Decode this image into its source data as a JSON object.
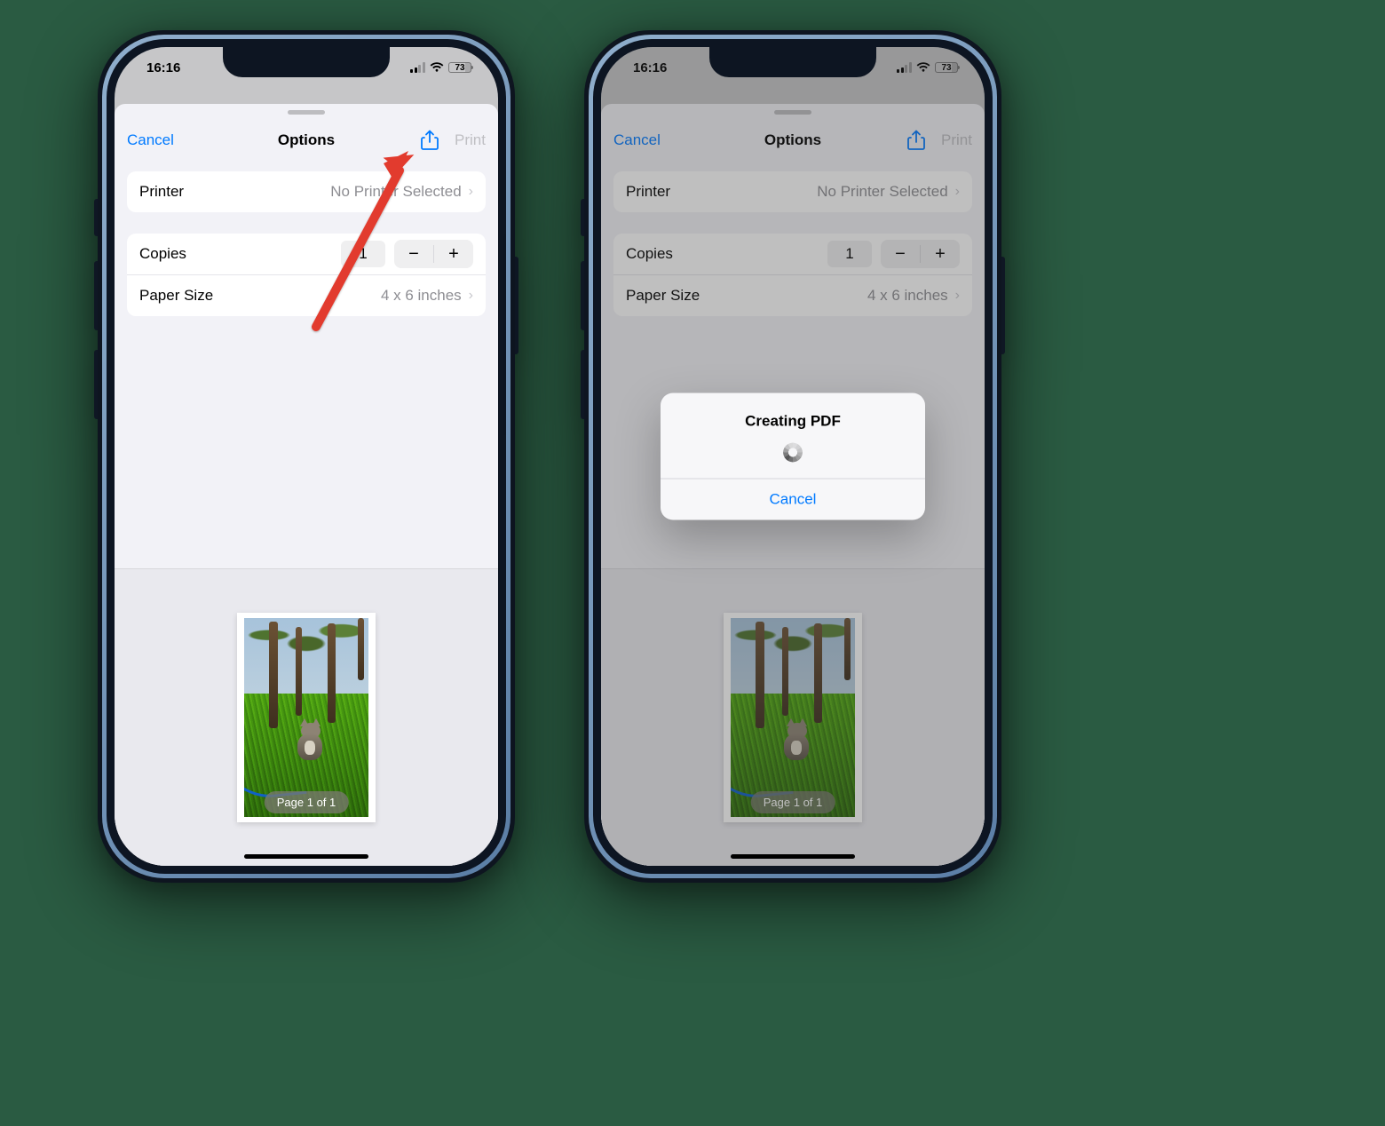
{
  "status": {
    "time": "16:16",
    "battery": "73"
  },
  "nav": {
    "cancel": "Cancel",
    "title": "Options",
    "print": "Print"
  },
  "printer": {
    "label": "Printer",
    "value": "No Printer Selected"
  },
  "copies": {
    "label": "Copies",
    "value": "1",
    "minus": "−",
    "plus": "+"
  },
  "paper": {
    "label": "Paper Size",
    "value": "4 x 6 inches"
  },
  "preview": {
    "page_badge": "Page 1 of 1"
  },
  "alert": {
    "title": "Creating PDF",
    "cancel": "Cancel"
  }
}
